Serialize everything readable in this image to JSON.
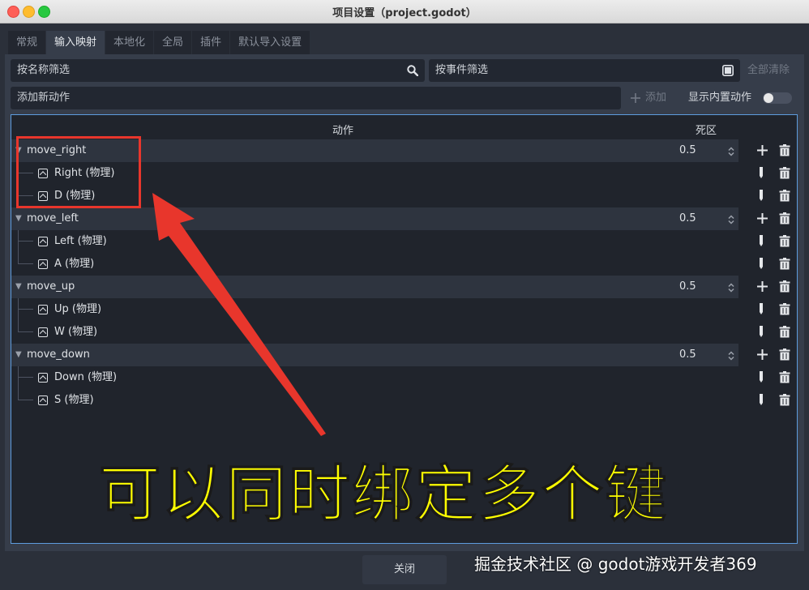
{
  "window": {
    "title": "项目设置（project.godot）"
  },
  "tabs": [
    {
      "label": "常规",
      "active": false
    },
    {
      "label": "输入映射",
      "active": true
    },
    {
      "label": "本地化",
      "active": false
    },
    {
      "label": "全局",
      "active": false
    },
    {
      "label": "插件",
      "active": false
    },
    {
      "label": "默认导入设置",
      "active": false
    }
  ],
  "filters": {
    "name_placeholder": "按名称筛选",
    "event_placeholder": "按事件筛选",
    "clear_all": "全部清除"
  },
  "add_action": {
    "placeholder": "添加新动作",
    "add_label": "添加",
    "show_builtin_label": "显示内置动作",
    "show_builtin_on": false
  },
  "table": {
    "col_action": "动作",
    "col_deadzone": "死区",
    "actions": [
      {
        "name": "move_right",
        "deadzone": "0.5",
        "events": [
          "Right (物理)",
          "D (物理)"
        ]
      },
      {
        "name": "move_left",
        "deadzone": "0.5",
        "events": [
          "Left (物理)",
          "A (物理)"
        ]
      },
      {
        "name": "move_up",
        "deadzone": "0.5",
        "events": [
          "Up (物理)",
          "W (物理)"
        ]
      },
      {
        "name": "move_down",
        "deadzone": "0.5",
        "events": [
          "Down (物理)",
          "S (物理)"
        ]
      }
    ]
  },
  "footer": {
    "close_label": "关闭"
  },
  "annotation": {
    "caption": "可以同时绑定多个键",
    "watermark": "掘金技术社区 @ godot游戏开发者369",
    "color": "#e8362c"
  }
}
